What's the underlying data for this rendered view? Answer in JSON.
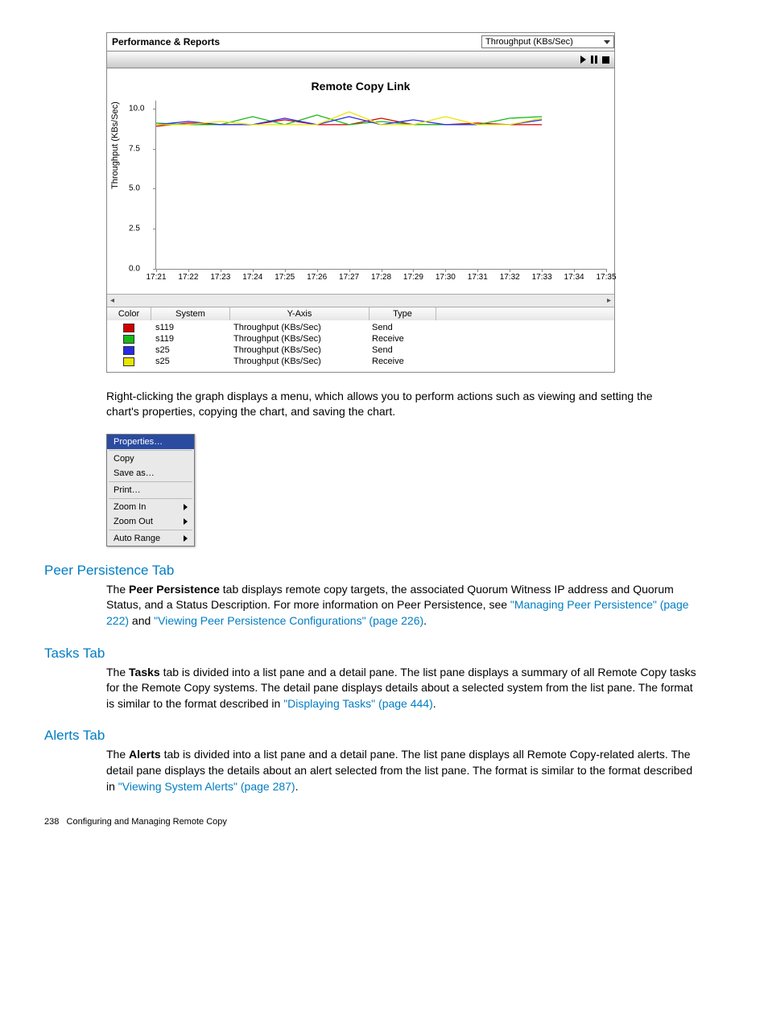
{
  "panel": {
    "title": "Performance & Reports",
    "dropdown": "Throughput (KBs/Sec)"
  },
  "chart_data": {
    "type": "line",
    "title": "Remote Copy Link",
    "ylabel": "Throughput (KBs/Sec)",
    "xlabel": "",
    "ylim": [
      0.0,
      10.5
    ],
    "y_ticks": [
      "0.0",
      "2.5",
      "5.0",
      "7.5",
      "10.0"
    ],
    "categories": [
      "17:21",
      "17:22",
      "17:23",
      "17:24",
      "17:25",
      "17:26",
      "17:27",
      "17:28",
      "17:29",
      "17:30",
      "17:31",
      "17:32",
      "17:33",
      "17:34",
      "17:35"
    ],
    "series": [
      {
        "name": "s119 Send",
        "color": "#d40000",
        "values": [
          8.9,
          9.1,
          9.0,
          9.0,
          9.3,
          9.0,
          9.0,
          9.4,
          9.0,
          9.0,
          9.1,
          9.0,
          9.0,
          null,
          null
        ]
      },
      {
        "name": "s119 Receive",
        "color": "#18b818",
        "values": [
          9.1,
          9.0,
          9.0,
          9.5,
          9.0,
          9.6,
          9.0,
          9.2,
          9.0,
          9.0,
          9.0,
          9.4,
          9.5,
          null,
          null
        ]
      },
      {
        "name": "s25 Send",
        "color": "#2a2ae6",
        "values": [
          9.0,
          9.2,
          9.0,
          9.0,
          9.4,
          9.0,
          9.5,
          9.0,
          9.3,
          9.0,
          9.0,
          9.0,
          9.3,
          null,
          null
        ]
      },
      {
        "name": "s25 Receive",
        "color": "#e6e600",
        "values": [
          9.0,
          9.0,
          9.2,
          9.0,
          9.0,
          9.0,
          9.8,
          9.0,
          9.0,
          9.5,
          9.0,
          9.0,
          9.4,
          null,
          null
        ]
      }
    ]
  },
  "legend": {
    "headers": {
      "color": "Color",
      "system": "System",
      "yaxis": "Y-Axis",
      "type": "Type"
    },
    "rows": [
      {
        "color": "#d40000",
        "system": "s119",
        "yaxis": "Throughput (KBs/Sec)",
        "type": "Send"
      },
      {
        "color": "#18b818",
        "system": "s119",
        "yaxis": "Throughput (KBs/Sec)",
        "type": "Receive"
      },
      {
        "color": "#2a2ae6",
        "system": "s25",
        "yaxis": "Throughput (KBs/Sec)",
        "type": "Send"
      },
      {
        "color": "#e6e600",
        "system": "s25",
        "yaxis": "Throughput (KBs/Sec)",
        "type": "Receive"
      }
    ]
  },
  "para1": "Right-clicking the graph displays a menu, which allows you to perform actions such as viewing and setting the chart's properties, copying the chart, and saving the chart.",
  "menu": {
    "properties": "Properties…",
    "copy": "Copy",
    "saveas": "Save as…",
    "print": "Print…",
    "zoomin": "Zoom In",
    "zoomout": "Zoom Out",
    "autorange": "Auto Range"
  },
  "sec1": {
    "title": "Peer Persistence Tab",
    "p1a": "The ",
    "p1b": "Peer Persistence",
    "p1c": " tab displays remote copy targets, the associated Quorum Witness IP address and Quorum Status, and a Status Description. For more information on Peer Persistence, see ",
    "link1": "\"Managing Peer Persistence\" (page 222)",
    "p1d": " and ",
    "link2": "\"Viewing Peer Persistence Configurations\" (page 226)",
    "p1e": "."
  },
  "sec2": {
    "title": "Tasks Tab",
    "p1a": "The ",
    "p1b": "Tasks",
    "p1c": " tab is divided into a list pane and a detail pane. The list pane displays a summary of all Remote Copy tasks for the Remote Copy systems. The detail pane displays details about a selected system from the list pane. The format is similar to the format described in ",
    "link1": "\"Displaying Tasks\" (page 444)",
    "p1d": "."
  },
  "sec3": {
    "title": "Alerts Tab",
    "p1a": "The ",
    "p1b": "Alerts",
    "p1c": " tab is divided into a list pane and a detail pane. The list pane displays all Remote Copy-related alerts. The detail pane displays the details about an alert selected from the list pane. The format is similar to the format described in ",
    "link1": "\"Viewing System Alerts\" (page 287)",
    "p1d": "."
  },
  "footer": {
    "page": "238",
    "chapter": "Configuring and Managing Remote Copy"
  }
}
